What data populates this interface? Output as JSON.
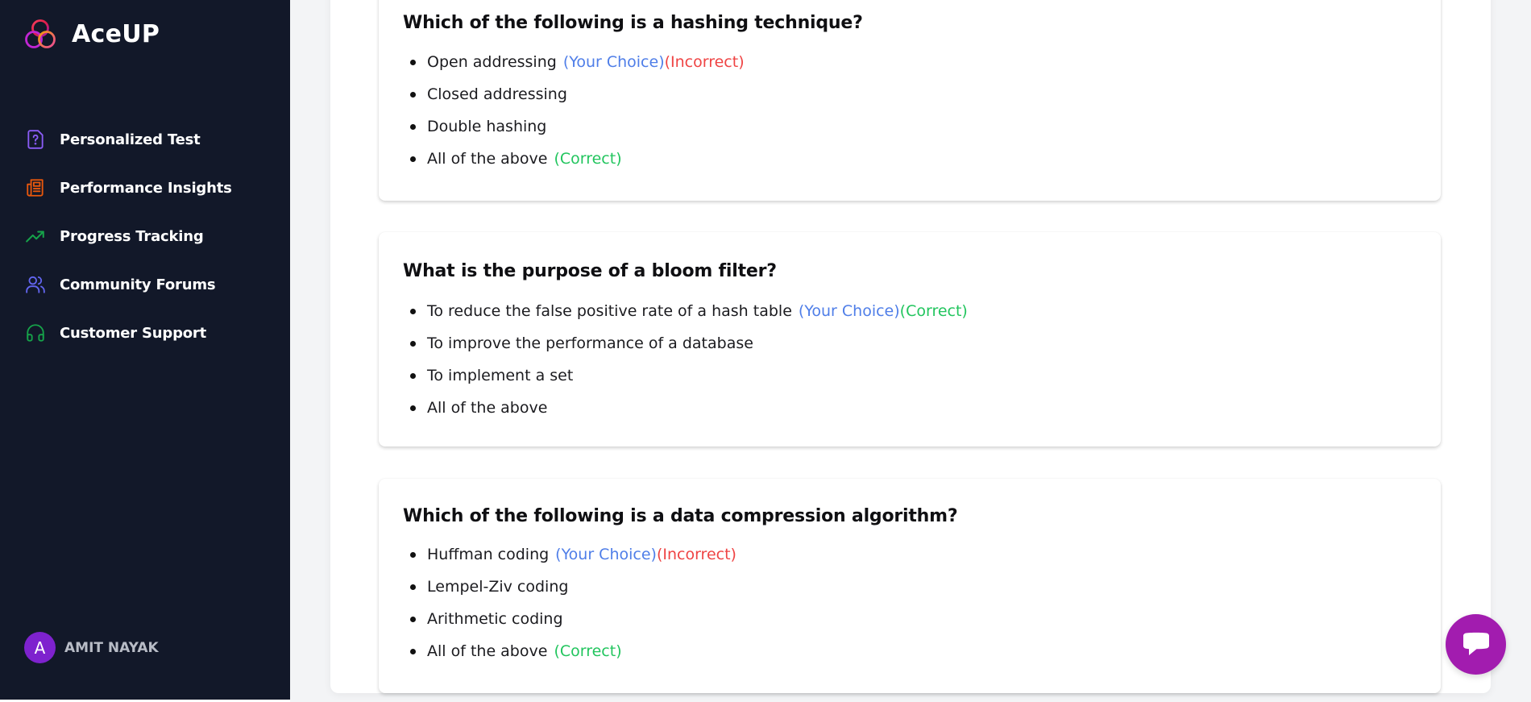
{
  "app": {
    "name": "AceUP"
  },
  "sidebar": {
    "items": [
      {
        "label": "Personalized Test",
        "icon": "question-file-icon",
        "color": "#8b5cf6"
      },
      {
        "label": "Performance Insights",
        "icon": "newspaper-icon",
        "color": "#ea580c"
      },
      {
        "label": "Progress Tracking",
        "icon": "trending-up-icon",
        "color": "#16a34a"
      },
      {
        "label": "Community Forums",
        "icon": "users-icon",
        "color": "#6366f1"
      },
      {
        "label": "Customer Support",
        "icon": "headphones-icon",
        "color": "#16a34a"
      }
    ]
  },
  "user": {
    "initial": "A",
    "name": "AMIT NAYAK"
  },
  "tags": {
    "your_choice": "(Your Choice)",
    "incorrect": "(Incorrect)",
    "correct": "(Correct)"
  },
  "questions": [
    {
      "text": "Which of the following is a hashing technique?",
      "options": [
        "Open addressing",
        "Closed addressing",
        "Double hashing",
        "All of the above"
      ]
    },
    {
      "text": "What is the purpose of a bloom filter?",
      "options": [
        "To reduce the false positive rate of a hash table",
        "To improve the performance of a database",
        "To implement a set",
        "All of the above"
      ]
    },
    {
      "text": "Which of the following is a data compression algorithm?",
      "options": [
        "Huffman coding",
        "Lempel-Ziv coding",
        "Arithmetic coding",
        "All of the above"
      ]
    }
  ],
  "chat": {
    "icon": "chat-bubble-icon"
  }
}
